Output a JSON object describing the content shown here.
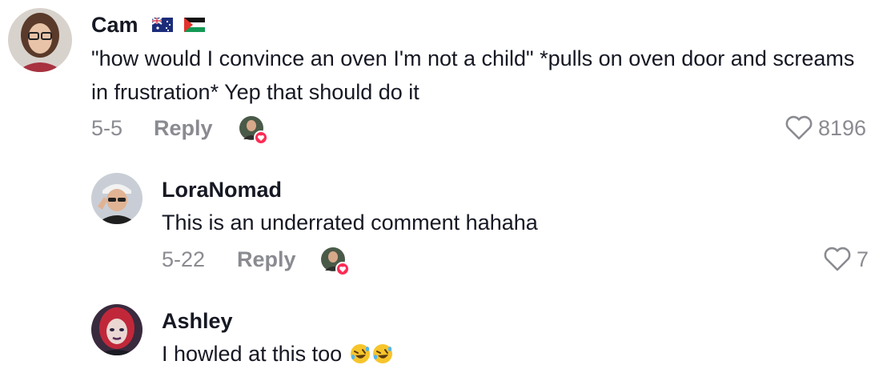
{
  "comments": [
    {
      "username": "Cam",
      "flags": [
        "australia-flag-icon",
        "palestine-flag-icon"
      ],
      "text": "\"how would I convince an oven I'm not a child\" *pulls on oven door and screams in frustration* Yep that should do it",
      "date": "5-5",
      "reply_label": "Reply",
      "likes": "8196"
    },
    {
      "username": "LoraNomad",
      "text": "This is an underrated comment hahaha",
      "date": "5-22",
      "reply_label": "Reply",
      "likes": "7"
    },
    {
      "username": "Ashley",
      "text": "I howled at this too",
      "emojis": [
        "rolling-on-floor-laughing-emoji",
        "rolling-on-floor-laughing-emoji"
      ]
    }
  ],
  "colors": {
    "text": "#161823",
    "muted": "#8a8b91",
    "heart_badge": "#fe2c55"
  }
}
